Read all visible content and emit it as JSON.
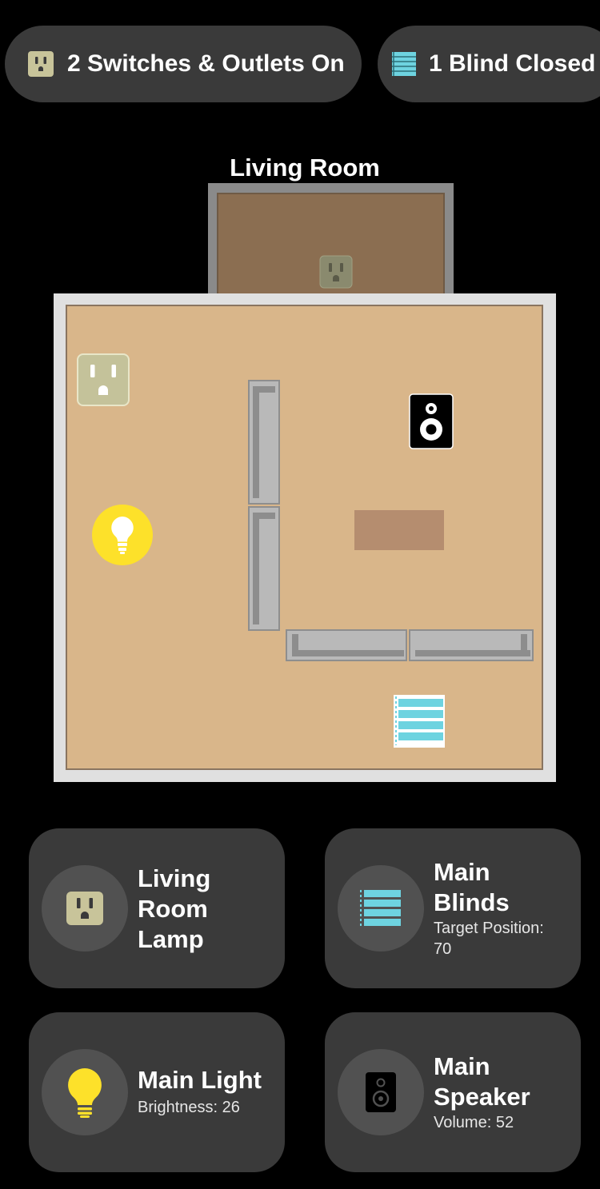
{
  "summary": {
    "switches_label": "2 Switches & Outlets On",
    "blinds_label": "1 Blind Closed"
  },
  "room": {
    "title": "Living Room"
  },
  "accessories": {
    "lamp": {
      "name_line1": "Living",
      "name_line2": "Room",
      "name_line3": "Lamp",
      "icon": "outlet-icon"
    },
    "blinds": {
      "name_line1": "Main",
      "name_line2": "Blinds",
      "status_line1": "Target Position:",
      "status_line2": "70",
      "icon": "blinds-icon"
    },
    "light": {
      "name": "Main Light",
      "status": "Brightness: 26",
      "icon": "lightbulb-icon"
    },
    "speaker": {
      "name_line1": "Main",
      "name_line2": "Speaker",
      "status": "Volume: 52",
      "icon": "speaker-icon"
    }
  },
  "colors": {
    "background": "#000000",
    "pill_bg": "#3a3a3a",
    "outlet": "#c8c49a",
    "blinds": "#6ed3e0",
    "bulb": "#ffd52a",
    "floor": "#d9b68a"
  }
}
